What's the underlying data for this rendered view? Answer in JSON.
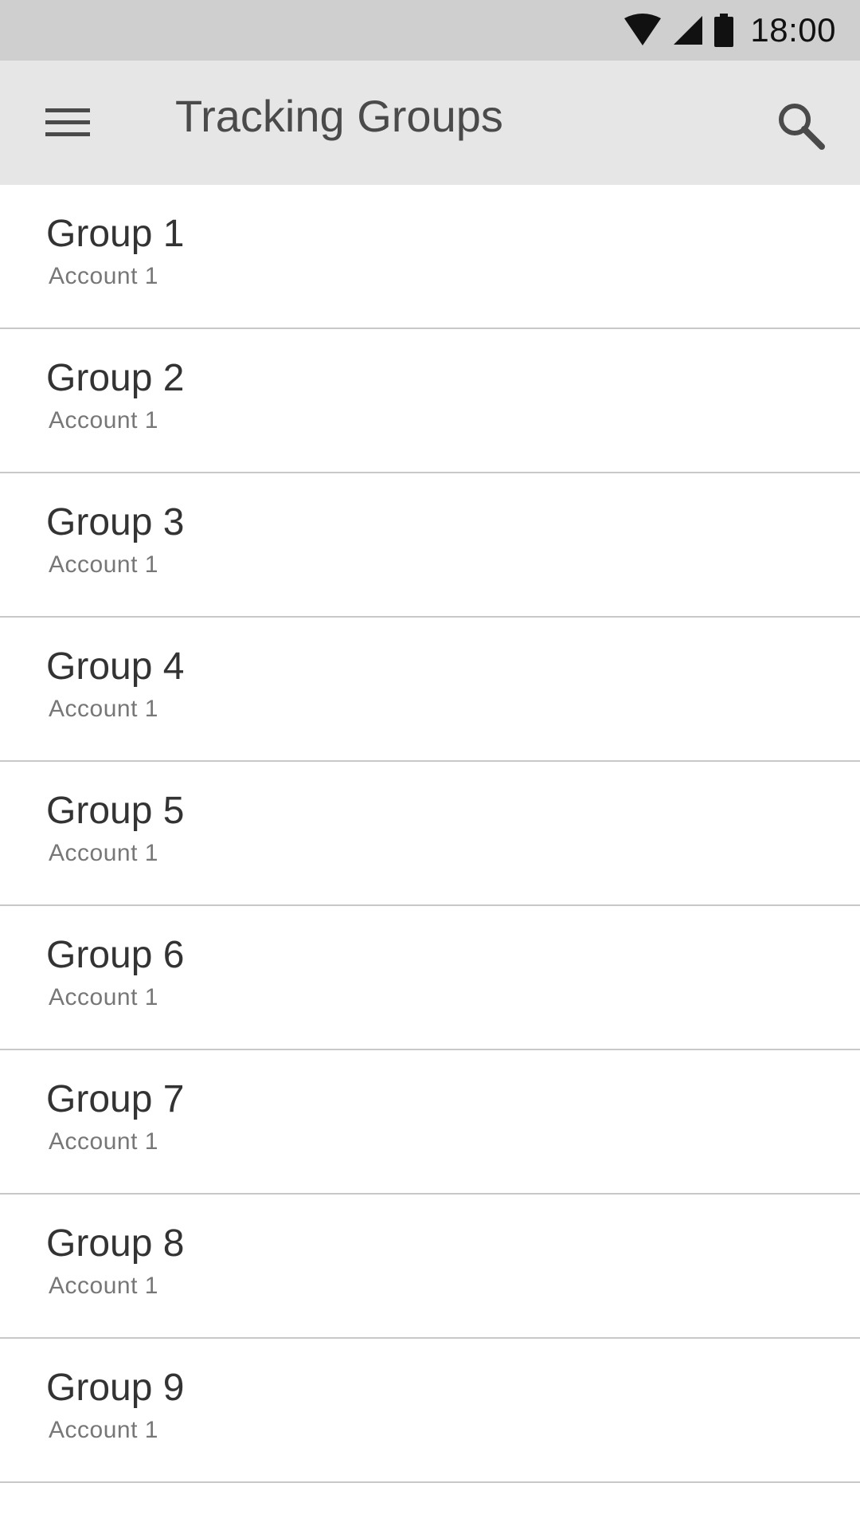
{
  "status_bar": {
    "time": "18:00",
    "icons": [
      "wifi-icon",
      "signal-icon",
      "battery-icon"
    ]
  },
  "app_bar": {
    "title": "Tracking Groups",
    "menu_icon": "hamburger-menu-icon",
    "search_icon": "search-icon",
    "background": "#e6e6e6"
  },
  "groups": [
    {
      "title": "Group 1",
      "subtitle": "Account 1"
    },
    {
      "title": "Group 2",
      "subtitle": "Account 1"
    },
    {
      "title": "Group 3",
      "subtitle": "Account 1"
    },
    {
      "title": "Group 4",
      "subtitle": "Account 1"
    },
    {
      "title": "Group 5",
      "subtitle": "Account 1"
    },
    {
      "title": "Group 6",
      "subtitle": "Account 1"
    },
    {
      "title": "Group 7",
      "subtitle": "Account 1"
    },
    {
      "title": "Group 8",
      "subtitle": "Account 1"
    },
    {
      "title": "Group 9",
      "subtitle": "Account 1"
    }
  ]
}
